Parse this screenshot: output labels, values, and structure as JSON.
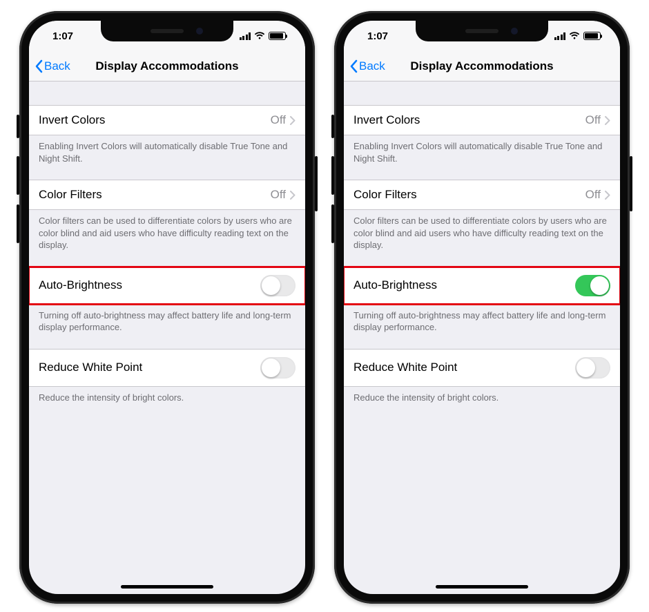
{
  "statusBar": {
    "time": "1:07"
  },
  "nav": {
    "back": "Back",
    "title": "Display Accommodations"
  },
  "rows": {
    "invert": {
      "label": "Invert Colors",
      "value": "Off",
      "footer": "Enabling Invert Colors will automatically disable True Tone and Night Shift."
    },
    "colorFilters": {
      "label": "Color Filters",
      "value": "Off",
      "footer": "Color filters can be used to differentiate colors by users who are color blind and aid users who have difficulty reading text on the display."
    },
    "autoBrightness": {
      "label": "Auto-Brightness",
      "footer": "Turning off auto-brightness may affect battery life and long-term display performance."
    },
    "reduceWhitePoint": {
      "label": "Reduce White Point",
      "footer": "Reduce the intensity of bright colors."
    }
  },
  "phones": [
    {
      "autoBrightnessOn": false,
      "reduceWhitePointOn": false
    },
    {
      "autoBrightnessOn": true,
      "reduceWhitePointOn": false
    }
  ]
}
